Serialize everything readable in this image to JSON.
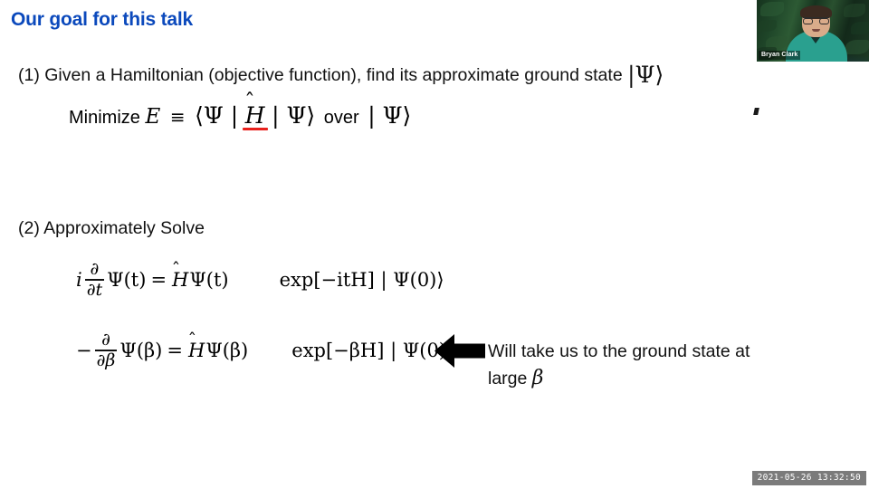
{
  "slide": {
    "title": "Our goal for this talk",
    "title_color": "#0B49BC",
    "background_color": "#FFFFFF",
    "points": [
      {
        "prefix": "(1)",
        "text": "(1) Given a Hamiltonian (objective function), find its approximate ground state",
        "trailing_ket": "|Ψ⟩"
      },
      {
        "prefix": "(2)",
        "text": "(2) Approximately Solve"
      }
    ],
    "minimize": {
      "lead": "Minimize",
      "symbol_E": "E",
      "equiv": "≡",
      "bra": "⟨Ψ |",
      "operator": "H",
      "operator_hat": "̂",
      "ket": "| Ψ⟩",
      "over": "over",
      "state": "| Ψ⟩",
      "underline_color": "#E8201C"
    },
    "equations": [
      {
        "id": "schrodinger-time",
        "lhs_prefix": "i",
        "frac_num": "∂",
        "frac_den": "∂t",
        "lhs_state": "Ψ(t)",
        "equals": "=",
        "rhs_operator": "H",
        "rhs_state": "Ψ(t)",
        "propagator": "exp[−itH] | Ψ(0)⟩"
      },
      {
        "id": "schrodinger-imaginary-time",
        "lhs_prefix": "−",
        "frac_num": "∂",
        "frac_den": "∂β",
        "lhs_state": "Ψ(β)",
        "equals": "=",
        "rhs_operator": "H",
        "rhs_state": "Ψ(β)",
        "propagator": "exp[−βH] | Ψ(0)⟩"
      }
    ],
    "annotation": {
      "arrow_direction": "left",
      "arrow_color": "#000000",
      "line1": "Will take us to the ground state at",
      "line2_lead": "large",
      "line2_symbol": "β"
    }
  },
  "webcam": {
    "speaker_name": "Bryan Clark"
  },
  "recording": {
    "timestamp": "2021-05-26 13:32:50"
  }
}
